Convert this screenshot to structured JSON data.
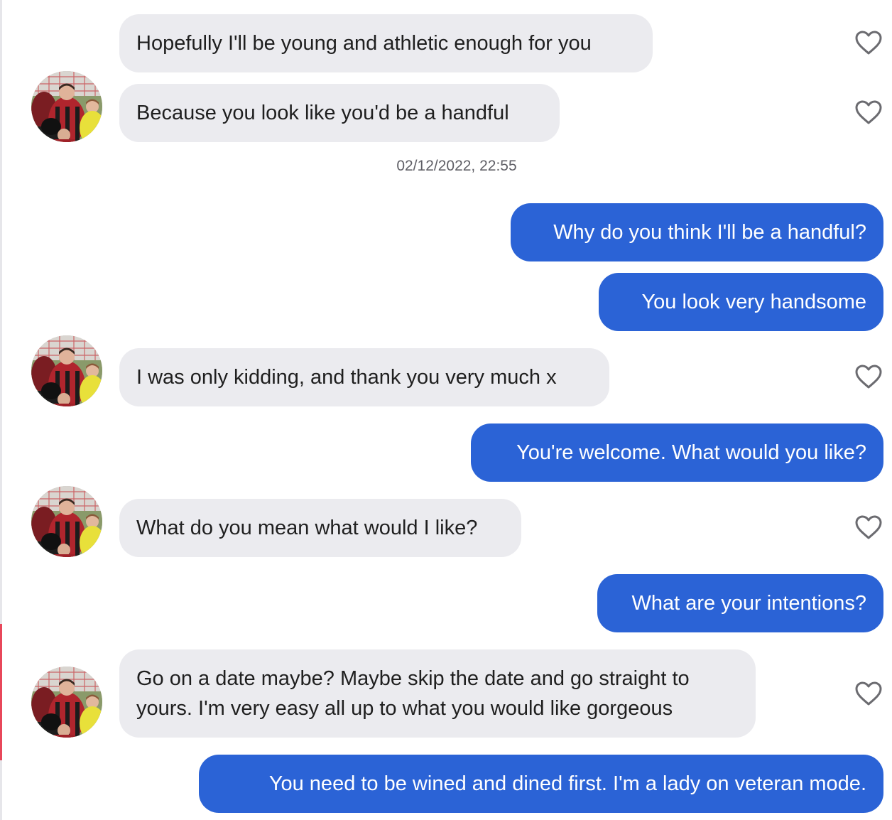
{
  "conversation": {
    "timestamp": "02/12/2022, 22:55",
    "messages": [
      {
        "from": "them",
        "text": "Hopefully I'll be young and athletic enough for you"
      },
      {
        "from": "them",
        "text": "Because you look like you'd be a handful"
      },
      {
        "from": "me",
        "text": "Why do you think I'll be a handful?"
      },
      {
        "from": "me",
        "text": "You look very handsome"
      },
      {
        "from": "them",
        "text": "I was only kidding, and thank you very much x"
      },
      {
        "from": "me",
        "text": "You're welcome. What would you like?"
      },
      {
        "from": "them",
        "text": "What do you mean what would I like?"
      },
      {
        "from": "me",
        "text": "What are your intentions?"
      },
      {
        "from": "them",
        "text": "Go on a date maybe? Maybe skip the date and go straight to yours. I'm very easy all up to what you would like gorgeous"
      },
      {
        "from": "me",
        "text": "You need to be wined and dined first. I'm a lady on veteran mode."
      }
    ]
  },
  "colors": {
    "incoming_bubble": "#ebebef",
    "outgoing_bubble": "#2b63d6",
    "timestamp_text": "#5f5f66",
    "heart_outline": "#6b6b70"
  },
  "icons": {
    "like": "heart-outline-icon",
    "avatar": "profile-photo"
  }
}
